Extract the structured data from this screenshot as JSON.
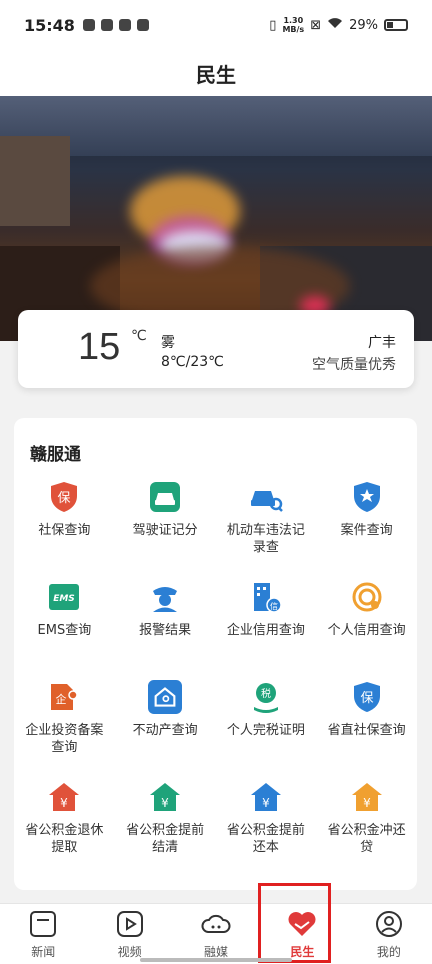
{
  "status": {
    "time": "15:48",
    "speed_top": "1.30",
    "speed_bot": "MB/s",
    "battery": "29%"
  },
  "header": {
    "title": "民生"
  },
  "weather": {
    "temp": "15",
    "unit": "℃",
    "condition": "雾",
    "range": "8℃/23℃",
    "city": "广丰",
    "air": "空气质量优秀"
  },
  "services": {
    "title": "赣服通",
    "items": [
      {
        "label": "社保查询",
        "icon": "shield-icon",
        "color": "#e0523a"
      },
      {
        "label": "驾驶证记分",
        "icon": "car-icon",
        "color": "#1fa37a"
      },
      {
        "label": "机动车违法记录查",
        "icon": "car-search-icon",
        "color": "#2b7fd4"
      },
      {
        "label": "案件查询",
        "icon": "badge-icon",
        "color": "#2b7fd4"
      },
      {
        "label": "EMS查询",
        "icon": "ems-icon",
        "color": "#1fa37a"
      },
      {
        "label": "报警结果",
        "icon": "police-icon",
        "color": "#2b7fd4"
      },
      {
        "label": "企业信用查询",
        "icon": "building-credit-icon",
        "color": "#2b7fd4"
      },
      {
        "label": "个人信用查询",
        "icon": "credit-icon",
        "color": "#f0a030"
      },
      {
        "label": "企业投资备案查询",
        "icon": "invest-icon",
        "color": "#e0602a"
      },
      {
        "label": "不动产查询",
        "icon": "house-search-icon",
        "color": "#2b7fd4"
      },
      {
        "label": "个人完税证明",
        "icon": "tax-icon",
        "color": "#1fa37a"
      },
      {
        "label": "省直社保查询",
        "icon": "shield-blue-icon",
        "color": "#2b7fd4"
      },
      {
        "label": "省公积金退休提取",
        "icon": "fund-icon",
        "color": "#e0523a"
      },
      {
        "label": "省公积金提前结清",
        "icon": "fund-icon",
        "color": "#1fa37a"
      },
      {
        "label": "省公积金提前还本",
        "icon": "fund-icon",
        "color": "#2b7fd4"
      },
      {
        "label": "省公积金冲还贷",
        "icon": "fund-icon",
        "color": "#f0a030"
      }
    ]
  },
  "tabs": [
    {
      "label": "新闻",
      "icon": "news-icon"
    },
    {
      "label": "视频",
      "icon": "video-icon"
    },
    {
      "label": "融媒",
      "icon": "cloud-icon"
    },
    {
      "label": "民生",
      "icon": "handshake-icon",
      "active": true
    },
    {
      "label": "我的",
      "icon": "user-icon"
    }
  ]
}
